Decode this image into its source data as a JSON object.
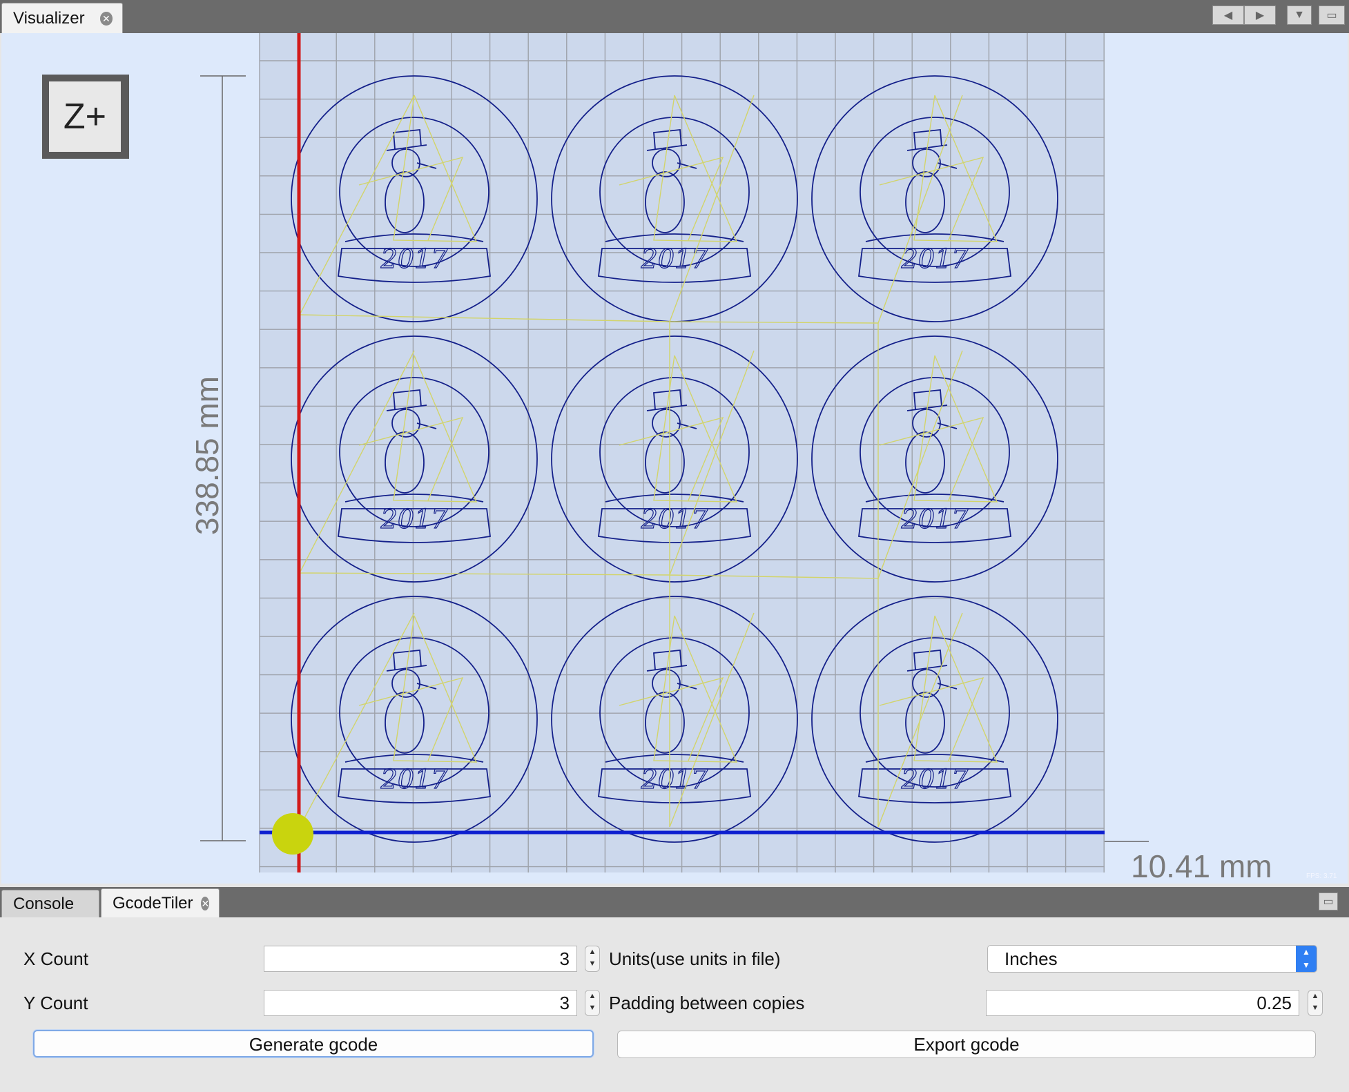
{
  "top_tabs": [
    {
      "label": "Visualizer"
    }
  ],
  "visualizer": {
    "z_button": "Z+",
    "dim_vertical": "338.85 mm",
    "dim_horizontal": "10.41 mm",
    "fps": "FPS: 3.71",
    "tile_text": "2017",
    "tiles": {
      "cols": 3,
      "rows": 3
    }
  },
  "bottom_tabs": [
    {
      "label": "Console"
    },
    {
      "label": "GcodeTiler"
    }
  ],
  "form": {
    "x_count_label": "X Count",
    "x_count_value": "3",
    "y_count_label": "Y Count",
    "y_count_value": "3",
    "units_label": "Units(use units in file)",
    "units_value": "Inches",
    "padding_label": "Padding between copies",
    "padding_value": "0.25",
    "generate_button": "Generate gcode",
    "export_button": "Export gcode"
  },
  "colors": {
    "grid_bg": "#ccd8ec",
    "grid_line": "#9ea2aa",
    "circle": "#14208a",
    "toolpath": "#d2d46a",
    "x_axis": "#0d1fd0",
    "y_axis": "#d21a1a",
    "tool": "#c9d40e"
  }
}
